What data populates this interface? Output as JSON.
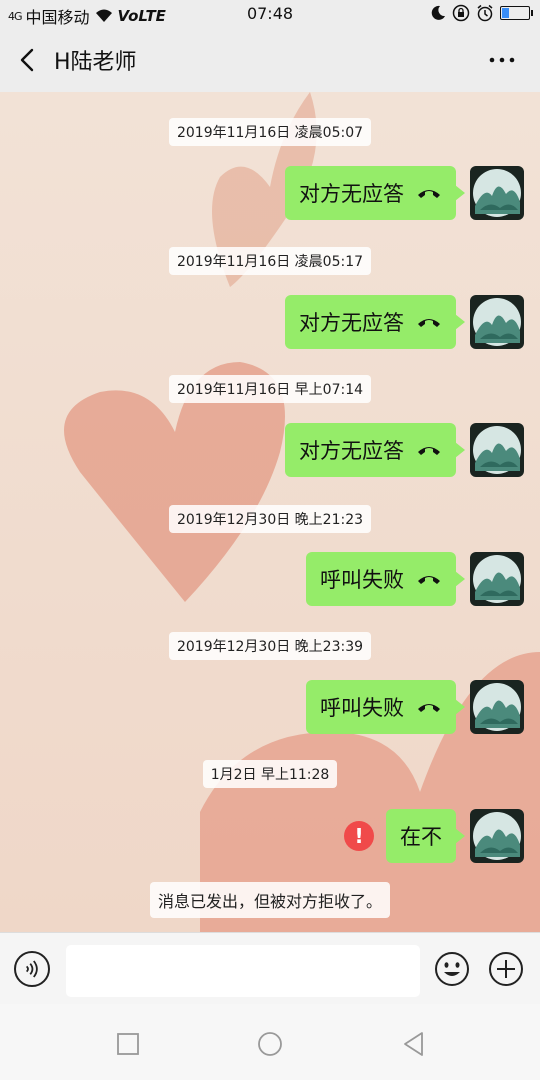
{
  "status_bar": {
    "signal": "4G",
    "carrier": "中国移动",
    "volte": "VoLTE",
    "time": "07:48",
    "battery_level": 0.25,
    "battery_color": "#3a8df5"
  },
  "header": {
    "title": "H陆老师",
    "back_icon": "chevron-left-icon",
    "more_icon": "more-dots-icon"
  },
  "messages": [
    {
      "timestamp": "2019年11月16日 凌晨05:07",
      "text": "对方无应答",
      "icon": "phone-hangup-icon"
    },
    {
      "timestamp": "2019年11月16日 凌晨05:17",
      "text": "对方无应答",
      "icon": "phone-hangup-icon"
    },
    {
      "timestamp": "2019年11月16日 早上07:14",
      "text": "对方无应答",
      "icon": "phone-hangup-icon"
    },
    {
      "timestamp": "2019年12月30日 晚上21:23",
      "text": "呼叫失败",
      "icon": "phone-hangup-icon"
    },
    {
      "timestamp": "2019年12月30日 晚上23:39",
      "text": "呼叫失败",
      "icon": "phone-hangup-icon"
    },
    {
      "timestamp": "1月2日 早上11:28",
      "text": "在不",
      "error": "!"
    }
  ],
  "system_notice": "消息已发出，但被对方拒收了。",
  "colors": {
    "bubble": "#95ec69",
    "error": "#f04a4a",
    "chat_background": "#f1ddd0"
  }
}
